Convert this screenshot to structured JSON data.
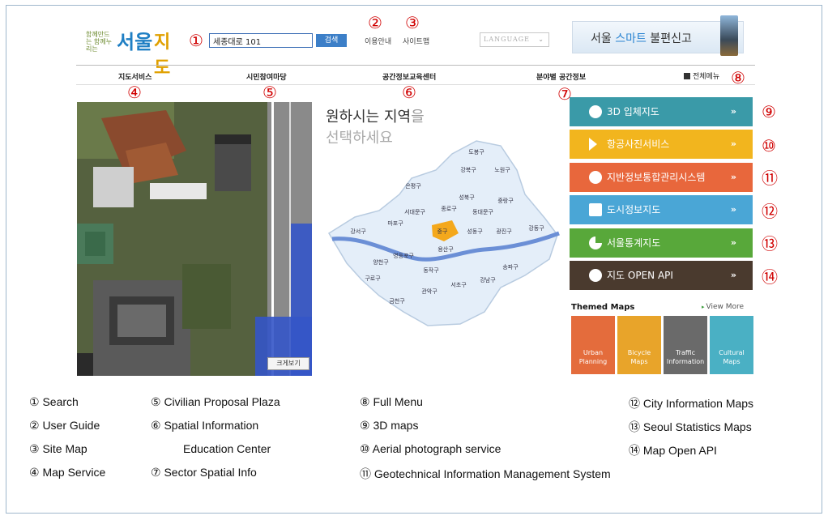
{
  "header": {
    "logo": {
      "slogan": "함께만드는 함께누리는",
      "seoul": "서울",
      "map": "지도"
    },
    "search": {
      "value": "세종대로 101",
      "button": "검색"
    },
    "links": {
      "user_guide": "이용안내",
      "site_map": "사이트맵"
    },
    "language": {
      "label": "LANGUAGE",
      "caret": "⌄"
    },
    "banner": {
      "prefix": "서울 ",
      "smart": "스마트",
      "suffix": " 불편신고"
    }
  },
  "nav": {
    "items": [
      "지도서비스",
      "시민참여마당",
      "공간정보교육센터",
      "분야별 공간정보"
    ],
    "full_menu": "전체메뉴"
  },
  "aerial": {
    "zoom_button": "크게보기"
  },
  "seoul_map": {
    "title_main": "원하시는 지역",
    "title_particle": "을",
    "subtitle": "선택하세요",
    "districts": [
      "도봉구",
      "강북구",
      "노원구",
      "은평구",
      "성북구",
      "중랑구",
      "서대문구",
      "종로구",
      "동대문구",
      "강서구",
      "마포구",
      "중구",
      "성동구",
      "광진구",
      "강동구",
      "양천구",
      "영등포구",
      "용산구",
      "송파구",
      "구로구",
      "동작구",
      "강남구",
      "금천구",
      "관악구",
      "서초구"
    ],
    "highlight": "중구",
    "highlight_color": "#f4a81c"
  },
  "services": [
    {
      "label": "3D 입체지도",
      "color": "#3a9aa8",
      "icon": "globe-icon"
    },
    {
      "label": "항공사진서비스",
      "color": "#f2b51e",
      "icon": "airplane-icon"
    },
    {
      "label": "지반정보통합관리시스템",
      "color": "#e8673c",
      "icon": "info-icon"
    },
    {
      "label": "도시정보지도",
      "color": "#4aa6d6",
      "icon": "building-icon"
    },
    {
      "label": "서울통계지도",
      "color": "#58a83a",
      "icon": "pie-chart-icon"
    },
    {
      "label": "지도 OPEN API",
      "color": "#4a3a2e",
      "icon": "gear-icon"
    }
  ],
  "arrow": "»",
  "themed": {
    "title": "Themed Maps",
    "view_more": "View More",
    "tiles": [
      {
        "label1": "Urban",
        "label2": "Planning",
        "color": "#e46c3c"
      },
      {
        "label1": "Bicycle",
        "label2": "Maps",
        "color": "#e8a42a"
      },
      {
        "label1": "Traffic",
        "label2": "Information",
        "color": "#6a6a6a"
      },
      {
        "label1": "Cultural",
        "label2": "Maps",
        "color": "#4ab0c4"
      }
    ]
  },
  "markers": [
    "①",
    "②",
    "③",
    "④",
    "⑤",
    "⑥",
    "⑦",
    "⑧",
    "⑨",
    "⑩",
    "⑪",
    "⑫",
    "⑬",
    "⑭"
  ],
  "legend": {
    "col1": [
      "① Search",
      "② User Guide",
      "③ Site Map",
      "④ Map Service"
    ],
    "col2": [
      "⑤ Civilian Proposal Plaza",
      "⑥ Spatial Information",
      "Education Center",
      "⑦ Sector Spatial Info"
    ],
    "col3": [
      "⑧ Full Menu",
      "⑨ 3D maps",
      "⑩ Aerial photograph service",
      "⑪ Geotechnical Information Management System"
    ],
    "col4": [
      "⑫ City Information Maps",
      "⑬ Seoul Statistics Maps",
      "⑭ Map Open API"
    ]
  }
}
